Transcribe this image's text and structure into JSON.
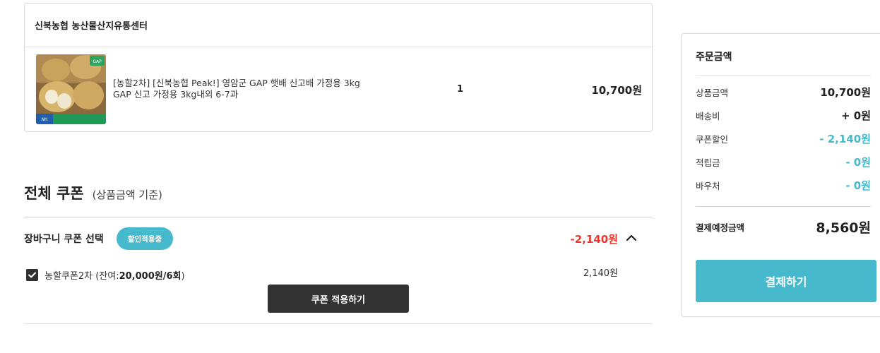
{
  "seller": {
    "name": "신북농협 농산물산지유통센터"
  },
  "product": {
    "name_line1": "[농할2차] [신북농협 Peak!] 영암군 GAP 햇배 신고배 가정용 3kg",
    "name_line2": "GAP 신고 가정용 3kg내외 6-7과",
    "quantity": "1",
    "price": "10,700원",
    "thumb_label": "신고배"
  },
  "coupon": {
    "title": "전체 쿠폰",
    "subtitle": "(상품금액 기준)",
    "cart_label": "장바구니 쿠폰 선택",
    "badge": "할인적용중",
    "discount": "-2,140원",
    "item_name": "농할쿠폰2차",
    "item_balance_prefix": "(잔여:",
    "item_balance": "20,000원/6회",
    "item_balance_suffix": ")",
    "item_amount": "2,140원",
    "item_checked": true,
    "apply_label": "쿠폰 적용하기"
  },
  "summary": {
    "title": "주문금액",
    "rows": [
      {
        "label": "상품금액",
        "value": "10,700원"
      },
      {
        "label": "배송비",
        "value": "+ 0원"
      },
      {
        "label": "쿠폰할인",
        "value": "- 2,140원"
      },
      {
        "label": "적립금",
        "value": "- 0원"
      },
      {
        "label": "바우처",
        "value": "- 0원"
      }
    ],
    "total_label": "결제예정금액",
    "total_value": "8,560원",
    "pay_label": "결제하기"
  },
  "colors": {
    "accent": "#46b9cc",
    "discount_red": "#e8382e",
    "dark_button": "#333333"
  }
}
